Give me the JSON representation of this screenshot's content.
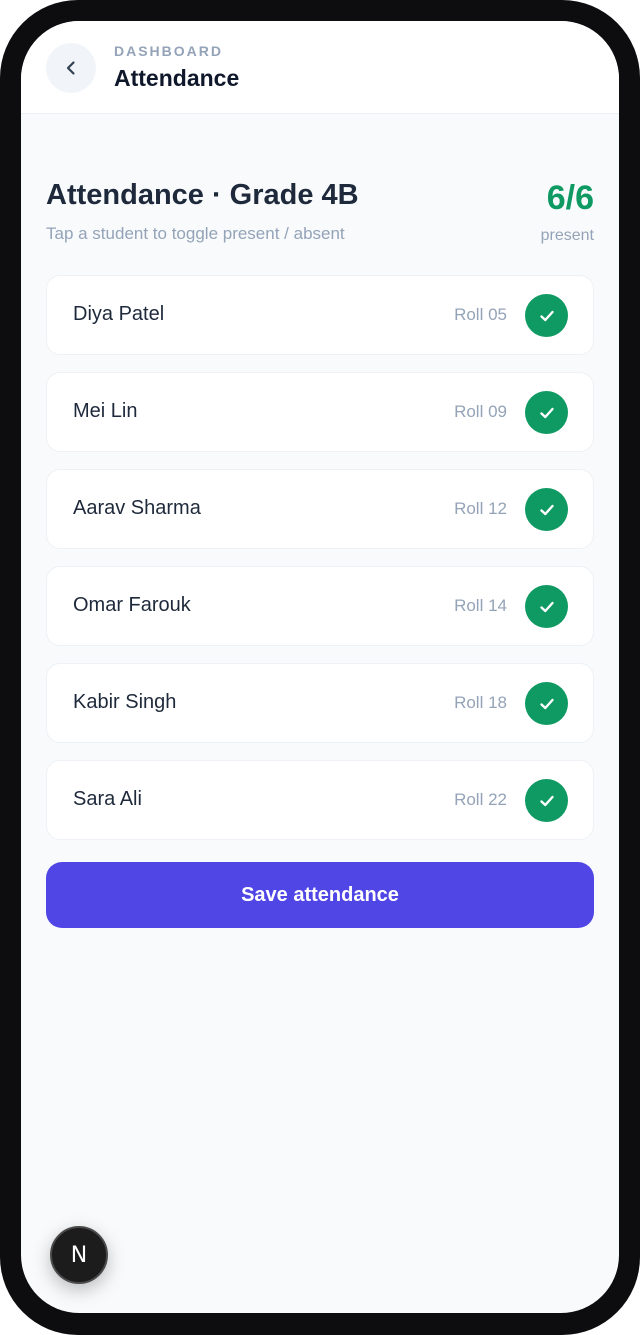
{
  "header": {
    "breadcrumb": "DASHBOARD",
    "title": "Attendance",
    "back_icon": "chevron-left-icon"
  },
  "section": {
    "title": "Attendance · Grade 4B",
    "subtitle": "Tap a student to toggle present / absent",
    "count": "6/6",
    "count_label": "present"
  },
  "students": [
    {
      "name": "Diya Patel",
      "roll": "Roll 05",
      "present": true
    },
    {
      "name": "Mei Lin",
      "roll": "Roll 09",
      "present": true
    },
    {
      "name": "Aarav Sharma",
      "roll": "Roll 12",
      "present": true
    },
    {
      "name": "Omar Farouk",
      "roll": "Roll 14",
      "present": true
    },
    {
      "name": "Kabir Singh",
      "roll": "Roll 18",
      "present": true
    },
    {
      "name": "Sara Ali",
      "roll": "Roll 22",
      "present": true
    }
  ],
  "actions": {
    "save_label": "Save attendance"
  },
  "dev_badge": {
    "letter": "N"
  },
  "colors": {
    "accent": "#5046e6",
    "present": "#0e9a62",
    "muted_text": "#94a3b8",
    "primary_text": "#1e293b",
    "background": "#f8fafc"
  }
}
